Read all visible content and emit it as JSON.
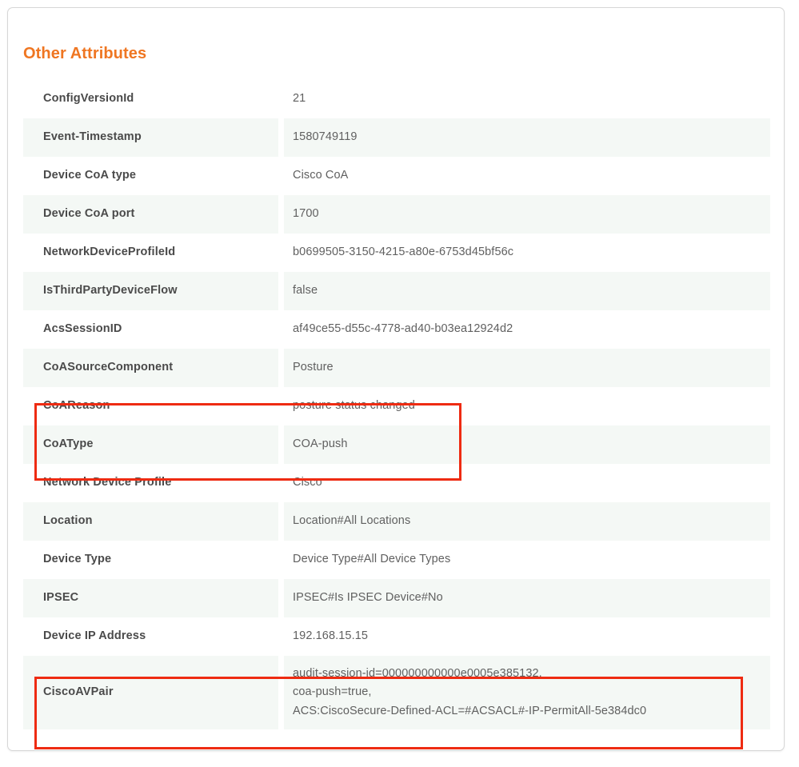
{
  "panel": {
    "title": "Other Attributes",
    "accent_color": "#ef7622",
    "highlight_color": "#ee2b12",
    "row_stripe_color": "#f4f8f5",
    "border_color": "#d7d7d7"
  },
  "attributes": [
    {
      "label": "ConfigVersionId",
      "value": "21"
    },
    {
      "label": "Event-Timestamp",
      "value": "1580749119"
    },
    {
      "label": "Device CoA type",
      "value": "Cisco CoA"
    },
    {
      "label": "Device CoA port",
      "value": "1700"
    },
    {
      "label": "NetworkDeviceProfileId",
      "value": "b0699505-3150-4215-a80e-6753d45bf56c"
    },
    {
      "label": "IsThirdPartyDeviceFlow",
      "value": "false"
    },
    {
      "label": "AcsSessionID",
      "value": "af49ce55-d55c-4778-ad40-b03ea12924d2"
    },
    {
      "label": "CoASourceComponent",
      "value": "Posture"
    },
    {
      "label": "CoAReason",
      "value": "posture status changed"
    },
    {
      "label": "CoAType",
      "value": "COA-push"
    },
    {
      "label": "Network Device Profile",
      "value": "Cisco"
    },
    {
      "label": "Location",
      "value": "Location#All Locations"
    },
    {
      "label": "Device Type",
      "value": "Device Type#All Device Types"
    },
    {
      "label": "IPSEC",
      "value": "IPSEC#Is IPSEC Device#No"
    },
    {
      "label": "Device IP Address",
      "value": "192.168.15.15"
    },
    {
      "label": "CiscoAVPair",
      "value": "audit-session-id=000000000000e0005e385132,\ncoa-push=true,\nACS:CiscoSecure-Defined-ACL=#ACSACL#-IP-PermitAll-5e384dc0"
    }
  ]
}
